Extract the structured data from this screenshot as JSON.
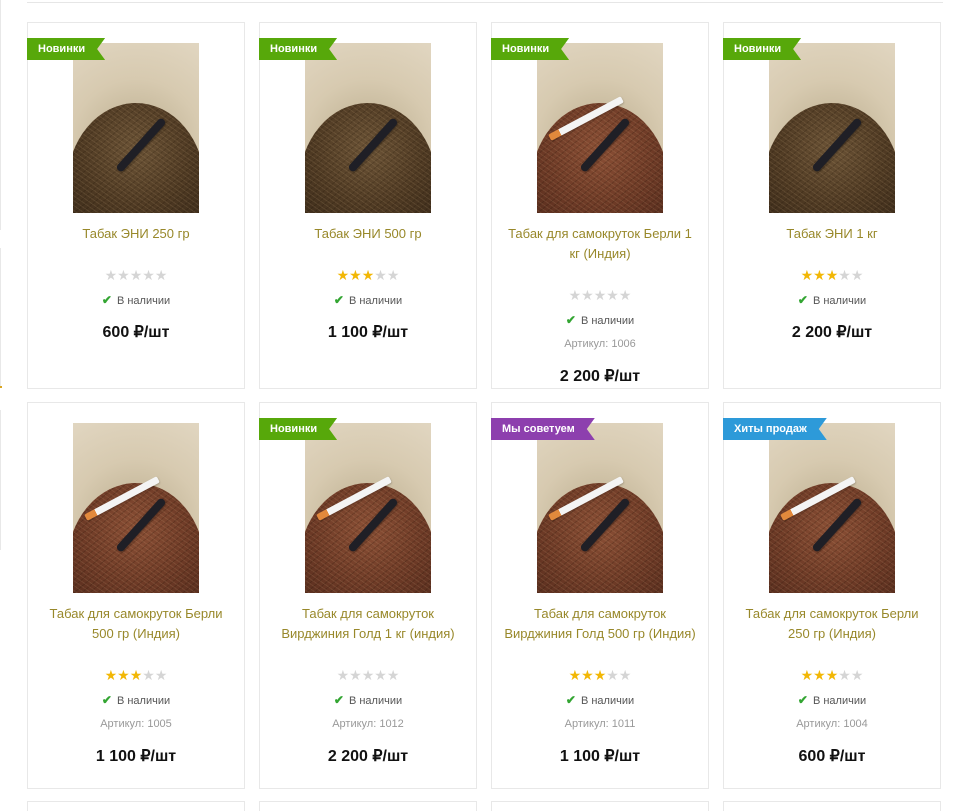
{
  "products": [
    {
      "badge": "Новинки",
      "badge_color": "#57a80a",
      "title": "Табак ЭНИ 250 гр",
      "rating": 0,
      "availability": "В наличии",
      "sku": "",
      "price": "600 ₽/шт",
      "image": "tobacco-pile-holder-icon"
    },
    {
      "badge": "Новинки",
      "badge_color": "#57a80a",
      "title": "Табак ЭНИ 500 гр",
      "rating": 3,
      "availability": "В наличии",
      "sku": "",
      "price": "1 100 ₽/шт",
      "image": "tobacco-pile-holder-icon"
    },
    {
      "badge": "Новинки",
      "badge_color": "#57a80a",
      "title": "Табак для самокруток Берли 1 кг (Индия)",
      "rating": 0,
      "availability": "В наличии",
      "sku": "Артикул: 1006",
      "price": "2 200 ₽/шт",
      "image": "tobacco-pile-cigarette-icon"
    },
    {
      "badge": "Новинки",
      "badge_color": "#57a80a",
      "title": "Табак ЭНИ 1 кг",
      "rating": 3,
      "availability": "В наличии",
      "sku": "",
      "price": "2 200 ₽/шт",
      "image": "tobacco-pile-holder-icon"
    },
    {
      "badge": "",
      "badge_color": "",
      "title": "Табак для самокруток Берли 500 гр (Индия)",
      "rating": 3,
      "availability": "В наличии",
      "sku": "Артикул: 1005",
      "price": "1 100 ₽/шт",
      "image": "tobacco-pile-cigarette-icon"
    },
    {
      "badge": "Новинки",
      "badge_color": "#57a80a",
      "title": "Табак для самокруток Вирджиния Голд 1 кг (индия)",
      "rating": 0,
      "availability": "В наличии",
      "sku": "Артикул: 1012",
      "price": "2 200 ₽/шт",
      "image": "tobacco-pile-cigarette-icon"
    },
    {
      "badge": "Мы советуем",
      "badge_color": "#8d3fae",
      "title": "Табак для самокруток Вирджиния Голд 500 гр (Индия)",
      "rating": 3,
      "availability": "В наличии",
      "sku": "Артикул: 1011",
      "price": "1 100 ₽/шт",
      "image": "tobacco-pile-cigarette-icon"
    },
    {
      "badge": "Хиты продаж",
      "badge_color": "#2d9ad9",
      "title": "Табак для самокруток Берли 250 гр (Индия)",
      "rating": 3,
      "availability": "В наличии",
      "sku": "Артикул: 1004",
      "price": "600 ₽/шт",
      "image": "tobacco-pile-cigarette-icon"
    }
  ],
  "rating_max": 5,
  "colors": {
    "title": "#98882a",
    "star_on": "#f2b705",
    "star_off": "#d5d5d5",
    "check": "#33a532"
  }
}
